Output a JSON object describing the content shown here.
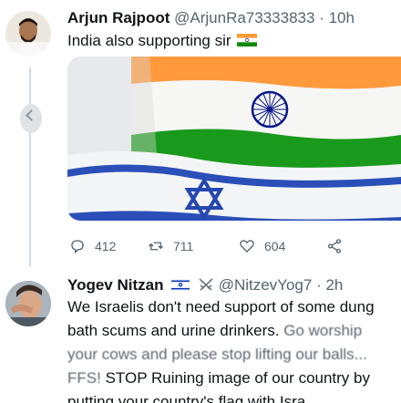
{
  "tweets": [
    {
      "display_name": "Arjun Rajpoot",
      "handle": "@ArjunRa73333833",
      "separator": "·",
      "time": "10h",
      "text": "India also supporting sir",
      "inline_flag": "india-flag-emoji",
      "actions": {
        "replies": "412",
        "retweets": "711",
        "likes": "604"
      }
    },
    {
      "display_name": "Yogev Nitzan",
      "flag_badge": "israel-flag-emoji",
      "swords_badge": "crossed-swords-emoji",
      "handle": "@NitzevYog7",
      "separator": "·",
      "time": "2h",
      "lines": [
        "We Israelis don't need support of some dung",
        "bath scums and urine drinkers.",
        "STOP Ruining image of our country by",
        "putting your country's flag with Isra"
      ],
      "scribbled_fragments": [
        "Go worship",
        "your cows and please stop lifting our balls...",
        "FFS!"
      ]
    }
  ],
  "colors": {
    "text": "#0f1419",
    "secondary": "#536471",
    "thread_line": "#cfd9de",
    "saffron": "#ff9933",
    "green": "#138808",
    "chakra": "#000080",
    "israel_blue": "#0038b8"
  }
}
